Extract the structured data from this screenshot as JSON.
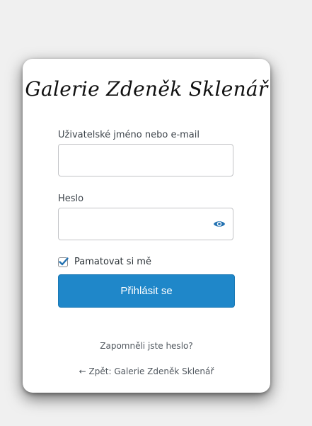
{
  "site": {
    "title": "Galerie Zdeněk Sklenář"
  },
  "form": {
    "username_label": "Uživatelské jméno nebo e-mail",
    "username_value": "",
    "password_label": "Heslo",
    "password_value": "",
    "remember_label": "Pamatovat si mě",
    "remember_checked": true,
    "submit_label": "Přihlásit se"
  },
  "links": {
    "lost_password": "Zapomněli jste heslo?",
    "back_to_site": "← Zpět: Galerie Zdeněk Sklenář"
  },
  "colors": {
    "primary": "#1f87c9",
    "background": "#f0f0f0"
  }
}
